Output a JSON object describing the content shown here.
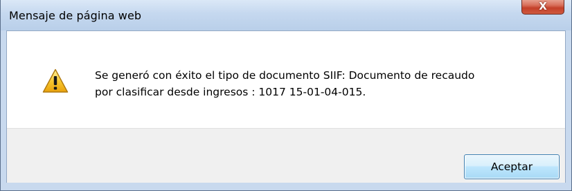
{
  "window": {
    "title": "Mensaje de página web",
    "close_label": "X"
  },
  "message": {
    "icon": "warning-icon",
    "text_line1": "Se generó con éxito el tipo de documento SIIF: Documento de recaudo",
    "text_line2": "por clasificar desde ingresos : 1017 15-01-04-015."
  },
  "buttons": {
    "ok_label": "Aceptar"
  },
  "colors": {
    "titlebar": "#c5d8ef",
    "close_button": "#c4402a",
    "ok_button_border": "#3c7fb1",
    "warning_yellow": "#f7c52c"
  }
}
